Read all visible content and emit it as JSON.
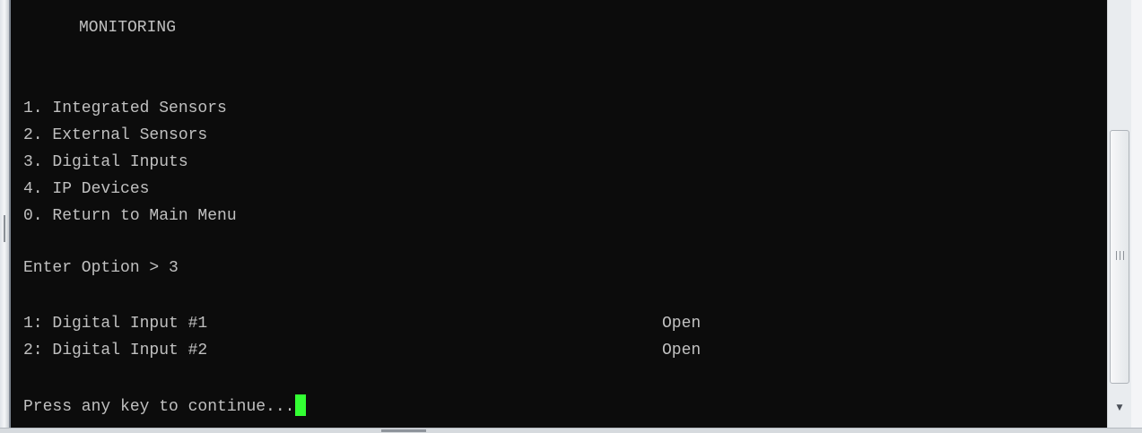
{
  "terminal": {
    "title": "MONITORING",
    "menu": [
      "1. Integrated Sensors",
      "2. External Sensors",
      "3. Digital Inputs",
      "4. IP Devices",
      "0. Return to Main Menu"
    ],
    "prompt": "Enter Option > 3",
    "inputs": [
      {
        "label": "1: Digital Input #1",
        "status": "Open"
      },
      {
        "label": "2: Digital Input #2",
        "status": "Open"
      }
    ],
    "continue_prompt": "Press any key to continue..."
  },
  "colors": {
    "background": "#0c0c0c",
    "text": "#c0c0c0",
    "cursor": "#33ff33"
  },
  "icons": {
    "scroll_grip": "scroll-grip-icon",
    "scroll_down": "scroll-down-arrow-icon"
  }
}
